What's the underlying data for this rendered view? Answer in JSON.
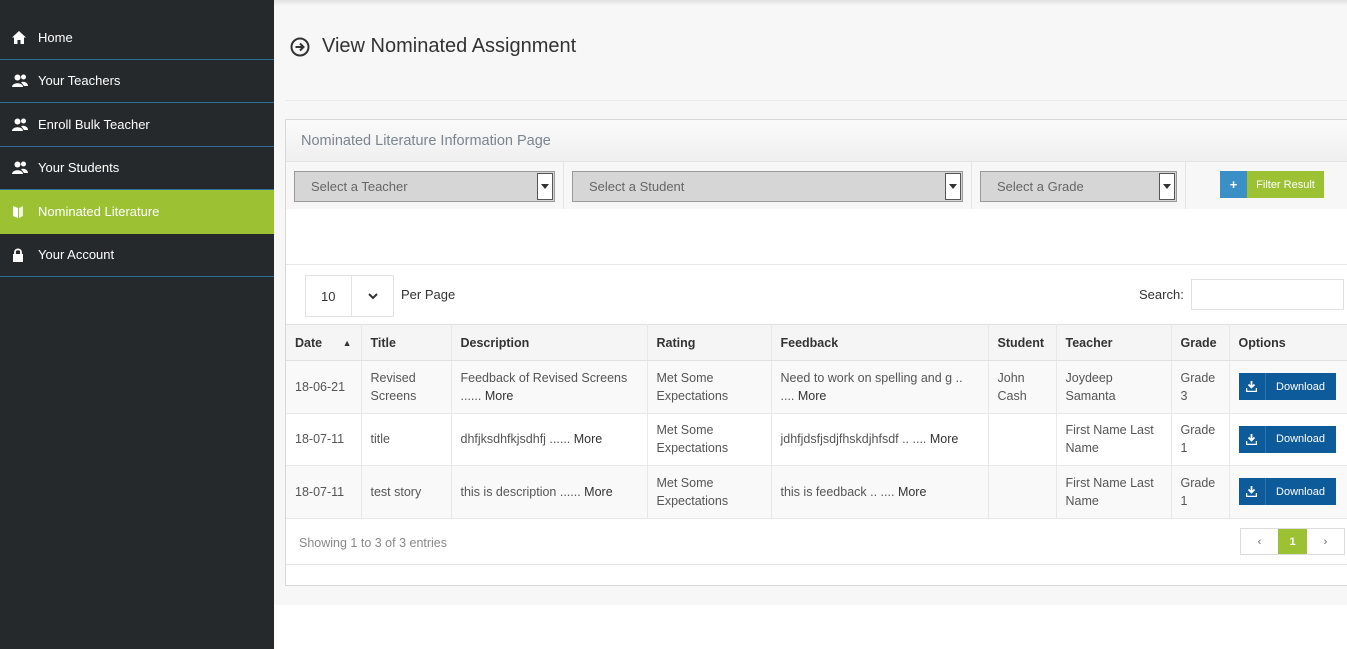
{
  "sidebar": {
    "items": [
      {
        "label": "Home",
        "icon": "home-icon"
      },
      {
        "label": "Your Teachers",
        "icon": "users-icon"
      },
      {
        "label": "Enroll Bulk Teacher",
        "icon": "users-icon"
      },
      {
        "label": "Your Students",
        "icon": "users-icon"
      },
      {
        "label": "Nominated Literature",
        "icon": "book-icon",
        "active": true
      },
      {
        "label": "Your Account",
        "icon": "lock-icon"
      }
    ]
  },
  "page": {
    "title": "View Nominated Assignment",
    "title_icon": "arrow-circle-right-icon"
  },
  "panel": {
    "header": "Nominated Literature Information Page",
    "filters": {
      "teacher_placeholder": "Select a Teacher",
      "student_placeholder": "Select a Student",
      "grade_placeholder": "Select a Grade",
      "filter_button": "Filter Result",
      "filter_button_icon": "+"
    },
    "per_page": {
      "value": "10",
      "label": "Per Page"
    },
    "search": {
      "label": "Search:",
      "value": ""
    },
    "table": {
      "columns": [
        "Date",
        "Title",
        "Description",
        "Rating",
        "Feedback",
        "Student",
        "Teacher",
        "Grade",
        "Options"
      ],
      "sort_column": "Date",
      "rows": [
        {
          "date": "18-06-21",
          "title": "Revised Screens",
          "description": "Feedback of Revised Screens ......",
          "rating": "Met Some Expectations",
          "feedback": "Need to work on spelling and g .. ....",
          "student": "John Cash",
          "teacher": "Joydeep Samanta",
          "grade": "Grade 3"
        },
        {
          "date": "18-07-11",
          "title": "title",
          "description": "dhfjksdhfkjsdhfj ......",
          "rating": "Met Some Expectations",
          "feedback": "jdhfjdsfjsdjfhskdjhfsdf .. ....",
          "student": "",
          "teacher": "First Name Last Name",
          "grade": "Grade 1"
        },
        {
          "date": "18-07-11",
          "title": "test story",
          "description": "this is description ......",
          "rating": "Met Some Expectations",
          "feedback": "this is feedback .. ....",
          "student": "",
          "teacher": "First Name Last Name",
          "grade": "Grade 1"
        }
      ],
      "more_label": "More",
      "download_label": "Download"
    },
    "footer": {
      "showing": "Showing 1 to 3 of 3 entries",
      "pager": {
        "prev": "‹",
        "current": "1",
        "next": "›"
      }
    }
  },
  "colors": {
    "sidebar_bg": "#26292c",
    "accent_green": "#9cc234",
    "download_blue": "#0e5b9c",
    "plus_blue": "#3b8fc7"
  }
}
